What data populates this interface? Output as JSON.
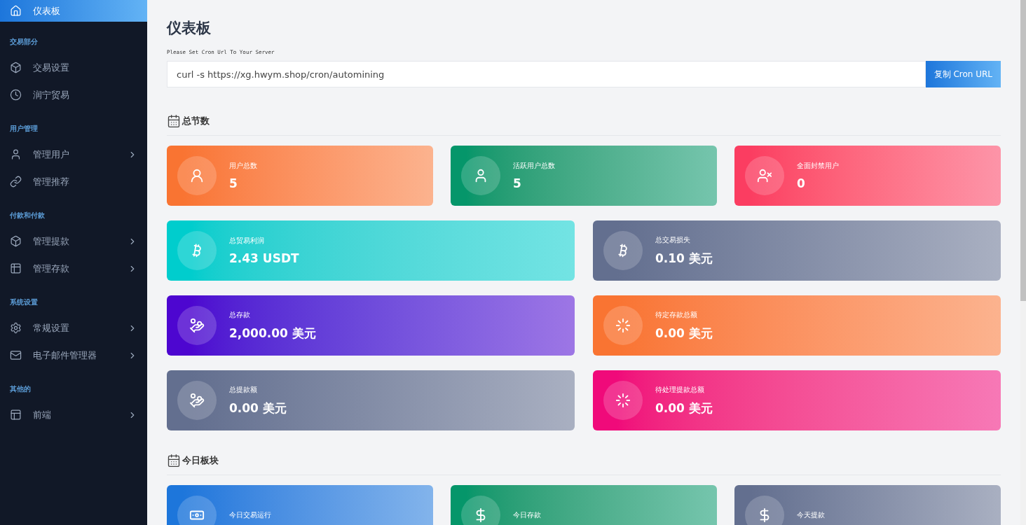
{
  "sidebar": {
    "groups": [
      {
        "items": [
          {
            "label": "仪表板",
            "kind": "home",
            "selected": true,
            "has_submenu": false
          }
        ]
      },
      {
        "title": "交易部分",
        "items": [
          {
            "label": "交易设置",
            "kind": "box",
            "selected": false,
            "has_submenu": false
          },
          {
            "label": "润宁贸易",
            "kind": "clock",
            "selected": false,
            "has_submenu": false
          }
        ]
      },
      {
        "title": "用户管理",
        "items": [
          {
            "label": "管理用户",
            "kind": "user",
            "selected": false,
            "has_submenu": true
          },
          {
            "label": "管理推荐",
            "kind": "link",
            "selected": false,
            "has_submenu": false
          }
        ]
      },
      {
        "title": "付款和付款",
        "items": [
          {
            "label": "管理提款",
            "kind": "box",
            "selected": false,
            "has_submenu": true
          },
          {
            "label": "管理存款",
            "kind": "table",
            "selected": false,
            "has_submenu": true
          }
        ]
      },
      {
        "title": "系统设置",
        "items": [
          {
            "label": "常规设置",
            "kind": "gear",
            "selected": false,
            "has_submenu": true
          },
          {
            "label": "电子邮件管理器",
            "kind": "mail",
            "selected": false,
            "has_submenu": true
          }
        ]
      },
      {
        "title": "其他的",
        "items": [
          {
            "label": "前端",
            "kind": "layout",
            "selected": false,
            "has_submenu": true
          }
        ]
      }
    ]
  },
  "page_title": "仪表板",
  "cron": {
    "label": "Please Set Cron Url To Your Server",
    "value": "curl -s https://xg.hwym.shop/cron/automining",
    "button": "复制 Cron URL"
  },
  "sections": [
    {
      "title": "总节数",
      "rows": [
        [
          {
            "label": "用户总数",
            "value": "5",
            "kind": "user",
            "color": "#f97432"
          },
          {
            "label": "活跃用户总数",
            "value": "5",
            "kind": "usertie",
            "color": "#05966a"
          },
          {
            "label": "全面封禁用户",
            "value": "0",
            "kind": "userx",
            "color": "#fb3d61"
          }
        ],
        [
          {
            "label": "总贸易利润",
            "value": "2.43 USDT",
            "kind": "bitcoin",
            "color": "#00cdcd"
          },
          {
            "label": "总交易损失",
            "value": "0.10 美元",
            "kind": "bitcoin",
            "color": "#636f8f"
          }
        ],
        [
          {
            "label": "总存款",
            "value": "2,000.00 美元",
            "kind": "hand",
            "color": "#4d06d0"
          },
          {
            "label": "待定存款总额",
            "value": "0.00 美元",
            "kind": "spinner",
            "color": "#f97432"
          }
        ],
        [
          {
            "label": "总提款额",
            "value": "0.00 美元",
            "kind": "hand",
            "color": "#636f8f"
          },
          {
            "label": "待处理提款总额",
            "value": "0.00 美元",
            "kind": "spinner",
            "color": "#f00a7a"
          }
        ]
      ]
    },
    {
      "title": "今日板块",
      "rows": [
        [
          {
            "label": "今日交易运行",
            "kind": "money",
            "color": "#1d76db"
          },
          {
            "label": "今日存款",
            "kind": "dollar",
            "color": "#05966a"
          },
          {
            "label": "今天提款",
            "kind": "dollar",
            "color": "#636f8f"
          }
        ]
      ]
    }
  ]
}
